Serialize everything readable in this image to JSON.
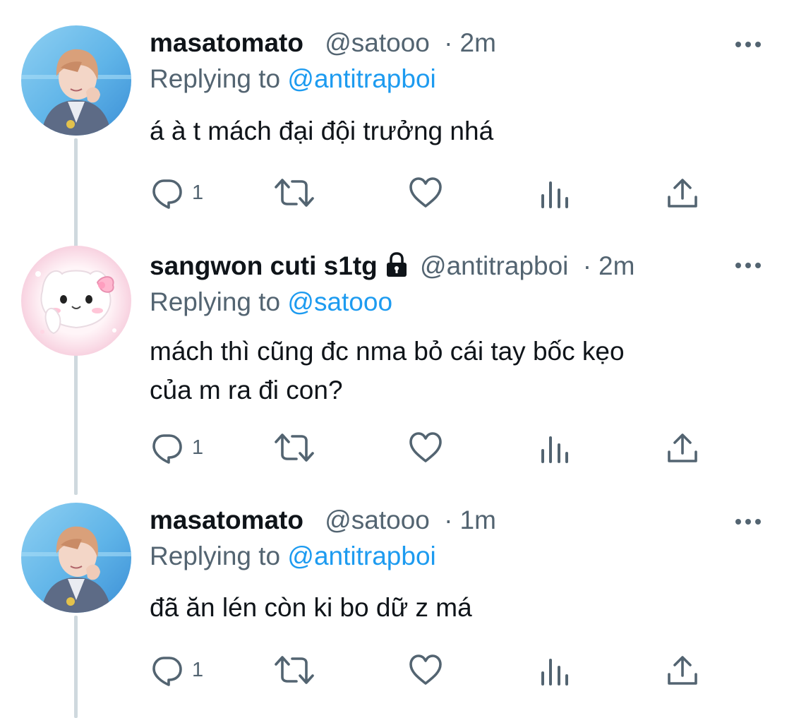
{
  "colors": {
    "name": "#0f1419",
    "meta": "#536471",
    "mention": "#1d9bf0",
    "thread_line": "#cfd9de",
    "icon": "#536471"
  },
  "tweets": [
    {
      "display_name": "masatomato",
      "handle": "@satooo",
      "time": "2m",
      "protected": false,
      "reply_prefix": "Replying to ",
      "reply_to": "@antitrapboi",
      "text_lines": [
        "á à t mách đại đội trưởng nhá"
      ],
      "reply_count": "1",
      "avatar_icon": "person-avatar-icon"
    },
    {
      "display_name": "sangwon cuti s1tg",
      "handle": "@antitrapboi",
      "time": "2m",
      "protected": true,
      "reply_prefix": "Replying to ",
      "reply_to": "@satooo",
      "text_lines": [
        "mách thì cũng đc nma bỏ cái tay bốc kẹo",
        "của m ra đi con?"
      ],
      "reply_count": "1",
      "avatar_icon": "cat-avatar-icon"
    },
    {
      "display_name": "masatomato",
      "handle": "@satooo",
      "time": "1m",
      "protected": false,
      "reply_prefix": "Replying to ",
      "reply_to": "@antitrapboi",
      "text_lines": [
        "đã ăn lén còn ki bo dữ z má"
      ],
      "reply_count": "1",
      "avatar_icon": "person-avatar-icon"
    }
  ],
  "meta_separator": "·"
}
